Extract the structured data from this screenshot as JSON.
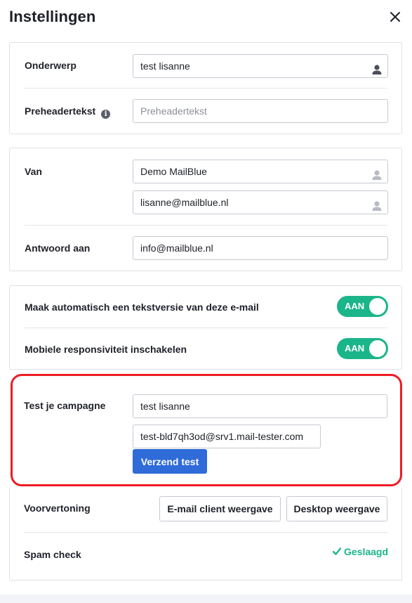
{
  "header": {
    "title": "Instellingen",
    "close_icon": "close-icon"
  },
  "subject_card": {
    "subject_label": "Onderwerp",
    "subject_value": "test lisanne",
    "preheader_label": "Preheadertekst",
    "preheader_placeholder": "Preheadertekst",
    "info_icon": "info-icon"
  },
  "sender_card": {
    "from_label": "Van",
    "from_name": "Demo MailBlue",
    "from_email": "lisanne@mailblue.nl",
    "reply_label": "Antwoord aan",
    "reply_value": "info@mailblue.nl"
  },
  "options_card": {
    "text_version_label": "Maak automatisch een tekstversie van deze e-mail",
    "text_version_toggle": "AAN",
    "text_version_on": true,
    "responsive_label": "Mobiele responsiviteit inschakelen",
    "responsive_toggle": "AAN",
    "responsive_on": true
  },
  "test_section": {
    "label": "Test je campagne",
    "name_value": "test lisanne",
    "email_value": "test-bld7qh3od@srv1.mail-tester.com",
    "send_button": "Verzend test"
  },
  "preview_section": {
    "label": "Voorvertoning",
    "email_client_button": "E-mail client weergave",
    "desktop_button": "Desktop weergave"
  },
  "spam_section": {
    "label": "Spam check",
    "status": "Geslaagd",
    "status_icon": "check-icon"
  },
  "colors": {
    "toggle_on": "#1bb58a",
    "primary_button": "#2f6bd9",
    "highlight_border": "#ee1c25",
    "success_text": "#1bb58a"
  }
}
